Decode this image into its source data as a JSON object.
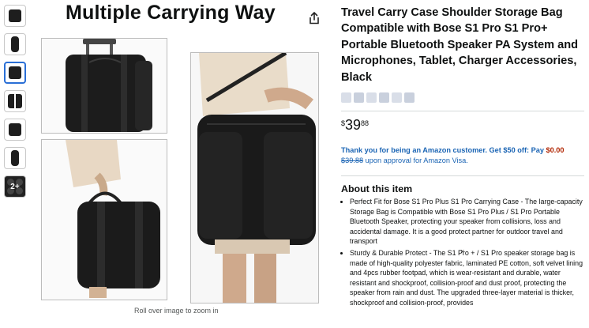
{
  "gallery": {
    "thumbnails": [
      {
        "icon": "product-thumbnail-icon",
        "active": false
      },
      {
        "icon": "product-thumbnail-icon",
        "active": false
      },
      {
        "icon": "product-thumbnail-icon",
        "active": true
      },
      {
        "icon": "product-thumbnail-icon",
        "active": false
      },
      {
        "icon": "product-thumbnail-icon",
        "active": false
      },
      {
        "icon": "product-thumbnail-icon",
        "active": false
      }
    ],
    "more_label": "2+",
    "headline": "Multiple Carrying Way",
    "zoom_hint": "Roll over image to zoom in",
    "share_icon": "share-icon"
  },
  "product": {
    "title": "Travel Carry Case Shoulder Storage Bag Compatible with Bose S1 Pro S1 Pro+ Portable Bluetooth Speaker PA System and Microphones, Tablet, Charger Accessories, Black",
    "price": {
      "symbol": "$",
      "whole": "39",
      "fraction": "88"
    },
    "promo": {
      "lead": "Thank you for being an Amazon customer. Get $50 off: Pay",
      "pay_amount": "$0.00",
      "old_price": "$39.88",
      "tail": "upon approval for Amazon Visa."
    },
    "about_heading": "About this item",
    "bullets": [
      "Perfect Fit for Bose S1 Pro Plus S1 Pro Carrying Case - The large-capacity Storage Bag is Compatible with Bose S1 Pro Plus / S1 Pro Portable Bluetooth Speaker, protecting your speaker from collisions, loss and accidental damage. It is a good protect partner for outdoor travel and transport",
      "Sturdy & Durable Protect - The S1 Pro + / S1 Pro speaker storage bag is made of high-quality polyester fabric, laminated PE cotton, soft velvet lining and 4pcs rubber footpad, which is wear-resistant and durable, water resistant and shockproof, collision-proof and dust proof, protecting the speaker from rain and dust. The upgraded three-layer material is thicker, shockproof and collision-proof, provides"
    ]
  },
  "overlay": {
    "close_glyph": "×"
  },
  "colors": {
    "link": "#1a64b4",
    "price_red": "#b12704",
    "active_thumb": "#2a6fd6"
  }
}
